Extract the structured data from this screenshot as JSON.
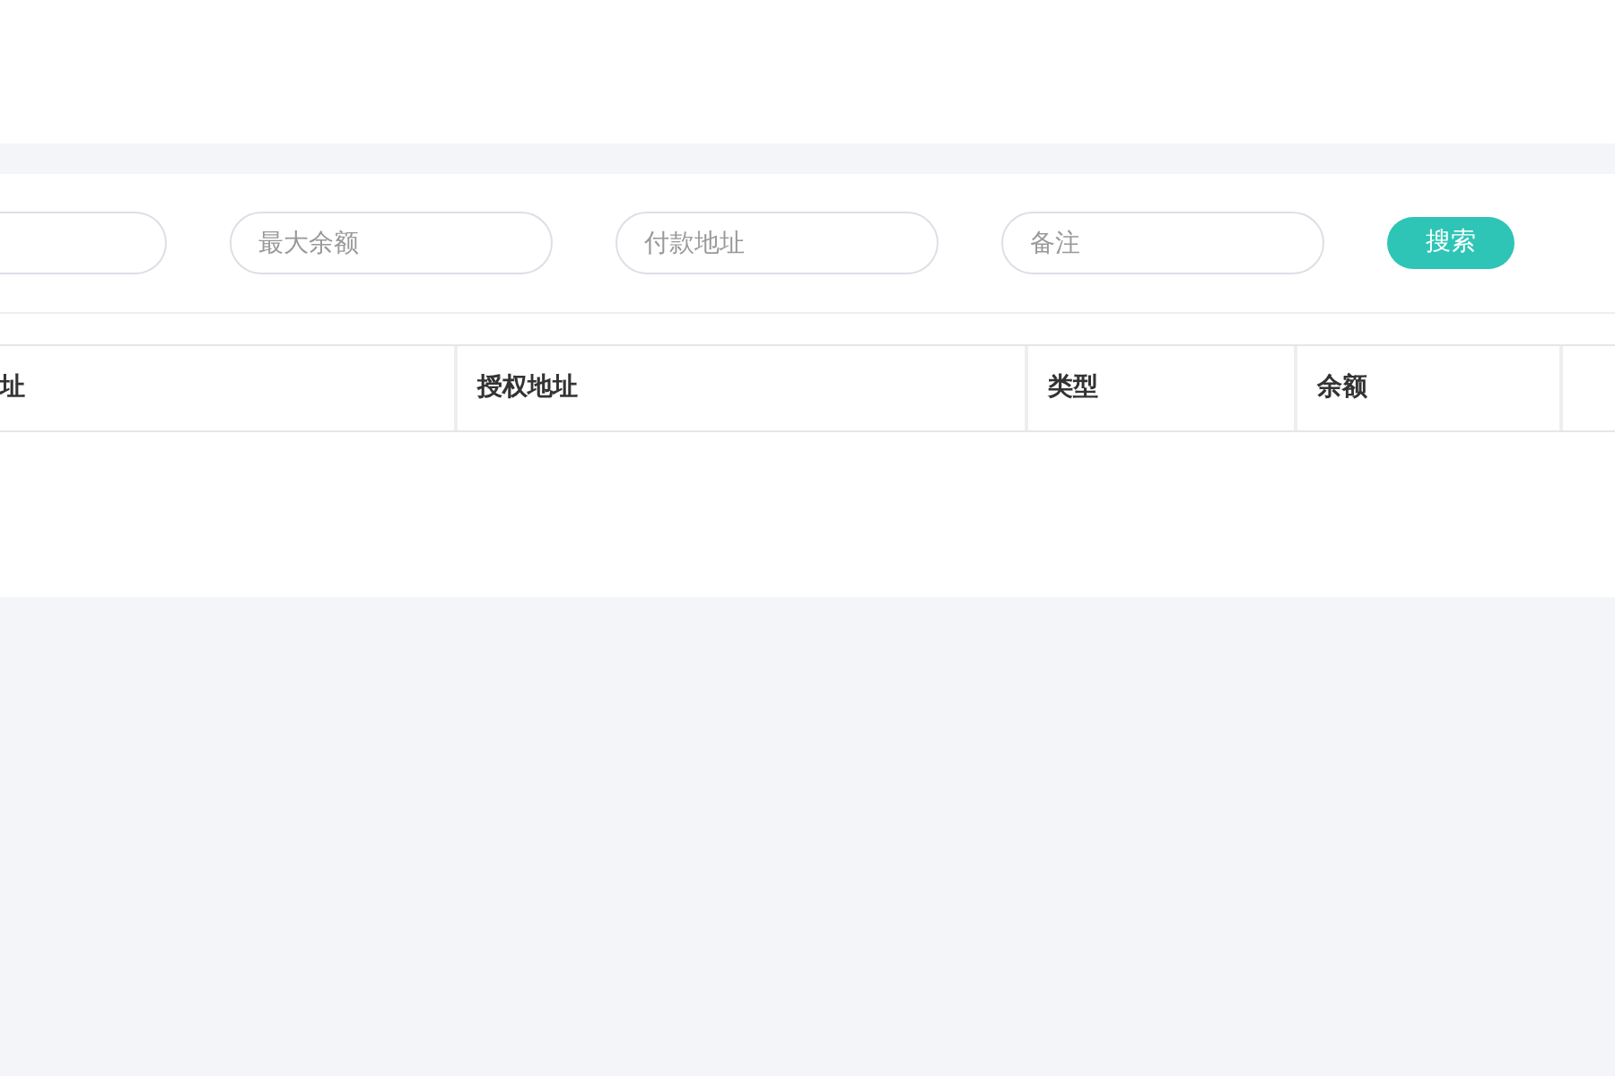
{
  "filters": [
    {
      "clipped": true
    },
    {
      "placeholder": "最大余额",
      "clipped": false
    },
    {
      "placeholder": "付款地址",
      "clipped": false
    },
    {
      "placeholder": "备注",
      "clipped": false
    }
  ],
  "search_button": {
    "label": "搜索"
  },
  "table": {
    "columns": [
      {
        "label": "址"
      },
      {
        "label": "授权地址"
      },
      {
        "label": "类型"
      },
      {
        "label": "余额"
      }
    ]
  }
}
